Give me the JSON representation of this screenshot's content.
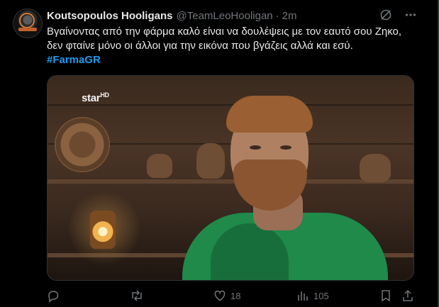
{
  "tweet": {
    "author_name": "Koutsopoulos Hooligans",
    "handle": "@TeamLeoHooligan",
    "separator": "·",
    "time": "2m",
    "text_line1": "Βγαίνοντας από την φάρμα καλό είναι να δουλέψεις με τον εαυτό σου Ζηκο,",
    "text_line2": "δεν φταίνε μόνο οι άλλοι για την εικόνα που βγάζεις αλλά και εσύ.",
    "hashtag": "#FarmaGR"
  },
  "media": {
    "channel_logo": "star",
    "channel_logo_suffix": "HD"
  },
  "actions": {
    "reply_count": "",
    "retweet_count": "",
    "like_count": "18",
    "views_count": "105"
  },
  "icons": {
    "grok": "slash-circle-icon",
    "more": "more-icon",
    "reply": "reply-icon",
    "retweet": "retweet-icon",
    "like": "heart-icon",
    "views": "views-icon",
    "bookmark": "bookmark-icon",
    "share": "share-icon"
  },
  "colors": {
    "background": "#000000",
    "text": "#e7e9ea",
    "muted": "#71767b",
    "link": "#1d9bf0"
  }
}
